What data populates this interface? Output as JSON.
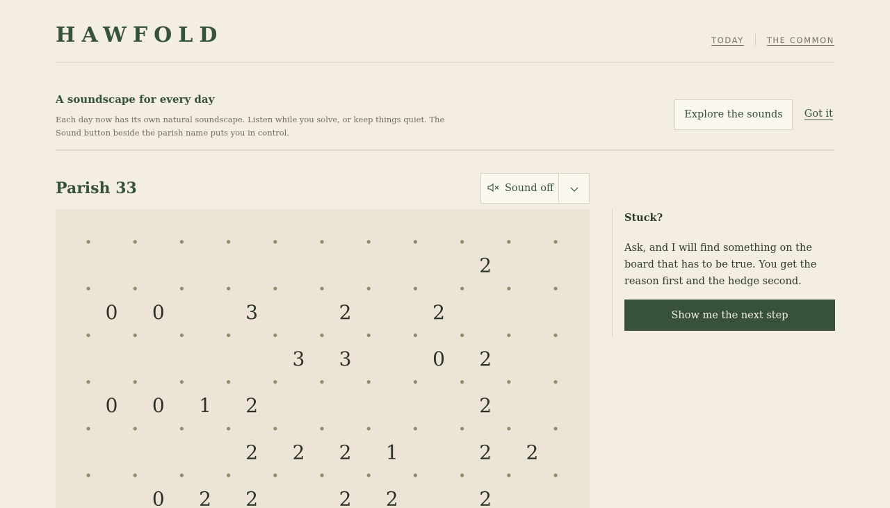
{
  "header": {
    "logo": "HAWFOLD",
    "nav": [
      {
        "label": "TODAY"
      },
      {
        "label": "THE COMMON"
      }
    ]
  },
  "notice": {
    "title": "A soundscape for every day",
    "body": "Each day now has its own natural soundscape. Listen while you solve, or keep things quiet. The Sound button beside the parish name puts you in control.",
    "explore_label": "Explore the sounds",
    "dismiss_label": "Got it"
  },
  "puzzle": {
    "title": "Parish 33",
    "sound_label": "Sound off",
    "sound_icon": "speaker-muted-icon",
    "dropdown_icon": "chevron-down-icon",
    "grid": {
      "dot_columns": 11,
      "dot_rows": 7,
      "clues": [
        [
          "",
          "",
          "",
          "",
          "",
          "",
          "",
          "",
          "2",
          ""
        ],
        [
          "0",
          "0",
          "",
          "3",
          "",
          "2",
          "",
          "2",
          "",
          ""
        ],
        [
          "",
          "",
          "",
          "",
          "3",
          "3",
          "",
          "0",
          "2",
          ""
        ],
        [
          "0",
          "0",
          "1",
          "2",
          "",
          "",
          "",
          "",
          "2",
          ""
        ],
        [
          "",
          "",
          "",
          "2",
          "2",
          "2",
          "1",
          "",
          "2",
          "2"
        ],
        [
          "",
          "0",
          "2",
          "2",
          "",
          "2",
          "2",
          "",
          "2",
          ""
        ]
      ]
    }
  },
  "help": {
    "title": "Stuck?",
    "body": "Ask, and I will find something on the board that has to be true. You get the reason first and the hedge second.",
    "button_label": "Show me the next step"
  },
  "colors": {
    "accent": "#375238",
    "background": "#f4eee2",
    "board": "#ece4d5",
    "dot": "#948a68"
  }
}
